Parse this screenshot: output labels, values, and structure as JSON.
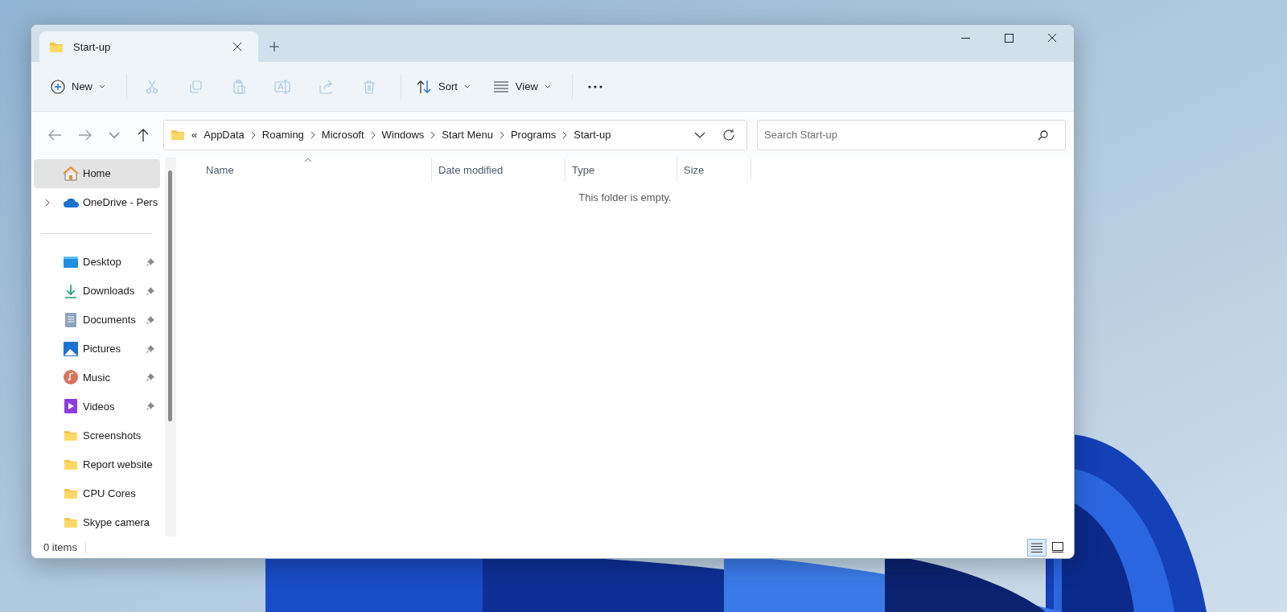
{
  "window": {
    "tab": {
      "title": "Start-up",
      "selected": true
    }
  },
  "toolbar": [
    {
      "kind": "menu",
      "label": "New",
      "disabled": false
    },
    {
      "kind": "separator"
    },
    {
      "kind": "icon",
      "disabled": true
    },
    {
      "kind": "icon",
      "disabled": true
    },
    {
      "kind": "icon",
      "disabled": true
    },
    {
      "kind": "icon",
      "disabled": true
    },
    {
      "kind": "icon",
      "disabled": true
    },
    {
      "kind": "icon",
      "disabled": true
    },
    {
      "kind": "separator"
    },
    {
      "kind": "menu",
      "label": "Sort",
      "disabled": false
    },
    {
      "kind": "menu",
      "label": "View",
      "disabled": false
    },
    {
      "kind": "separator"
    },
    {
      "kind": "more",
      "disabled": false
    }
  ],
  "navigation": [
    {
      "disabled": true
    },
    {
      "disabled": true
    },
    {
      "disabled": false
    },
    {
      "disabled": false
    }
  ],
  "address": {
    "overflow": "«",
    "segments": [
      "AppData",
      "Roaming",
      "Microsoft",
      "Windows",
      "Start Menu",
      "Programs",
      "Start-up"
    ]
  },
  "search": {
    "placeholder": "Search Start-up"
  },
  "sidebar": {
    "groups": [
      [
        {
          "label": "Home",
          "selected": true,
          "expandable": false,
          "pinned": false
        },
        {
          "label": "OneDrive - Pers",
          "selected": false,
          "expandable": true,
          "pinned": false
        }
      ],
      [
        {
          "label": "Desktop",
          "selected": false,
          "expandable": false,
          "pinned": true
        },
        {
          "label": "Downloads",
          "selected": false,
          "expandable": false,
          "pinned": true
        },
        {
          "label": "Documents",
          "selected": false,
          "expandable": false,
          "pinned": true
        },
        {
          "label": "Pictures",
          "selected": false,
          "expandable": false,
          "pinned": true
        },
        {
          "label": "Music",
          "selected": false,
          "expandable": false,
          "pinned": true
        },
        {
          "label": "Videos",
          "selected": false,
          "expandable": false,
          "pinned": true
        },
        {
          "label": "Screenshots",
          "selected": false,
          "expandable": false,
          "pinned": false
        },
        {
          "label": "Report website",
          "selected": false,
          "expandable": false,
          "pinned": false
        },
        {
          "label": "CPU Cores",
          "selected": false,
          "expandable": false,
          "pinned": false
        },
        {
          "label": "Skype camera",
          "selected": false,
          "expandable": false,
          "pinned": false
        }
      ]
    ]
  },
  "table": {
    "columns": [
      {
        "label": "Name",
        "sorted": true
      },
      {
        "label": "Date modified",
        "sorted": false
      },
      {
        "label": "Type",
        "sorted": false
      },
      {
        "label": "Size",
        "sorted": false
      }
    ],
    "empty_message": "This folder is empty."
  },
  "status_bar": {
    "item_count": "0 items",
    "view_modes": [
      {
        "selected": true
      },
      {
        "selected": false
      }
    ]
  }
}
